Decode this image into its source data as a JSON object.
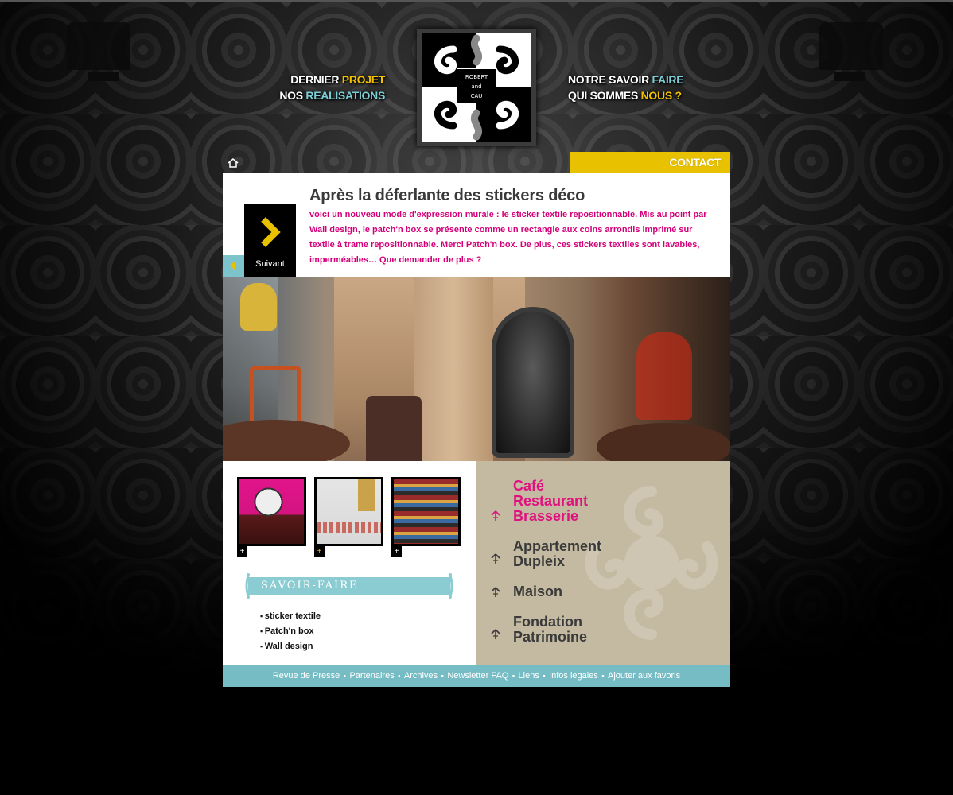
{
  "top_nav_left": [
    {
      "part1": "DERNIER ",
      "part2": "PROJET"
    },
    {
      "part1": "NOS ",
      "part2": "REALISATIONS"
    }
  ],
  "top_nav_right": [
    {
      "part1": "NOTRE SAVOIR ",
      "part2": "FAIRE"
    },
    {
      "part1": "QUI SOMMES ",
      "part2": "NOUS ?"
    }
  ],
  "logo": {
    "line1": "ROBERT",
    "line2": "and",
    "line3": "CAU"
  },
  "navbar": {
    "contact_label": "CONTACT"
  },
  "news": {
    "title": "Après la déferlante des stickers déco",
    "body": "voici un nouveau mode d'expression murale : le sticker textile repositionnable. Mis au point par Wall design, le patch'n box se présente comme un rectangle aux coins arrondis imprimé sur textile à trame repositionnable. Merci Patch'n box. De plus, ces stickers textiles sont lavables, imperméables… Que demander de plus ?",
    "next_label": "Suivant"
  },
  "thumbnails": [
    {
      "plus": "+"
    },
    {
      "plus": "+"
    },
    {
      "plus": "+"
    }
  ],
  "savoir_faire": {
    "title": "SAVOIR-FAIRE",
    "items": [
      "sticker textile",
      "Patch'n box",
      "Wall design"
    ]
  },
  "categories": [
    {
      "line1": "Café",
      "line2": "Restaurant",
      "line3": "Brasserie",
      "active": true
    },
    {
      "line1": "Appartement",
      "line2": "Dupleix",
      "active": false
    },
    {
      "line1": "Maison",
      "active": false
    },
    {
      "line1": "Fondation",
      "line2": "Patrimoine",
      "active": false
    }
  ],
  "footer_links": [
    "Revue de Presse",
    "Partenaires",
    "Archives",
    "Newsletter FAQ",
    "Liens",
    "Infos legales",
    "Ajouter aux favoris"
  ],
  "colors": {
    "accent_yellow": "#e8c100",
    "accent_cyan": "#76bcc4",
    "accent_pink": "#e0117f",
    "category_panel": "#c4baa1"
  }
}
